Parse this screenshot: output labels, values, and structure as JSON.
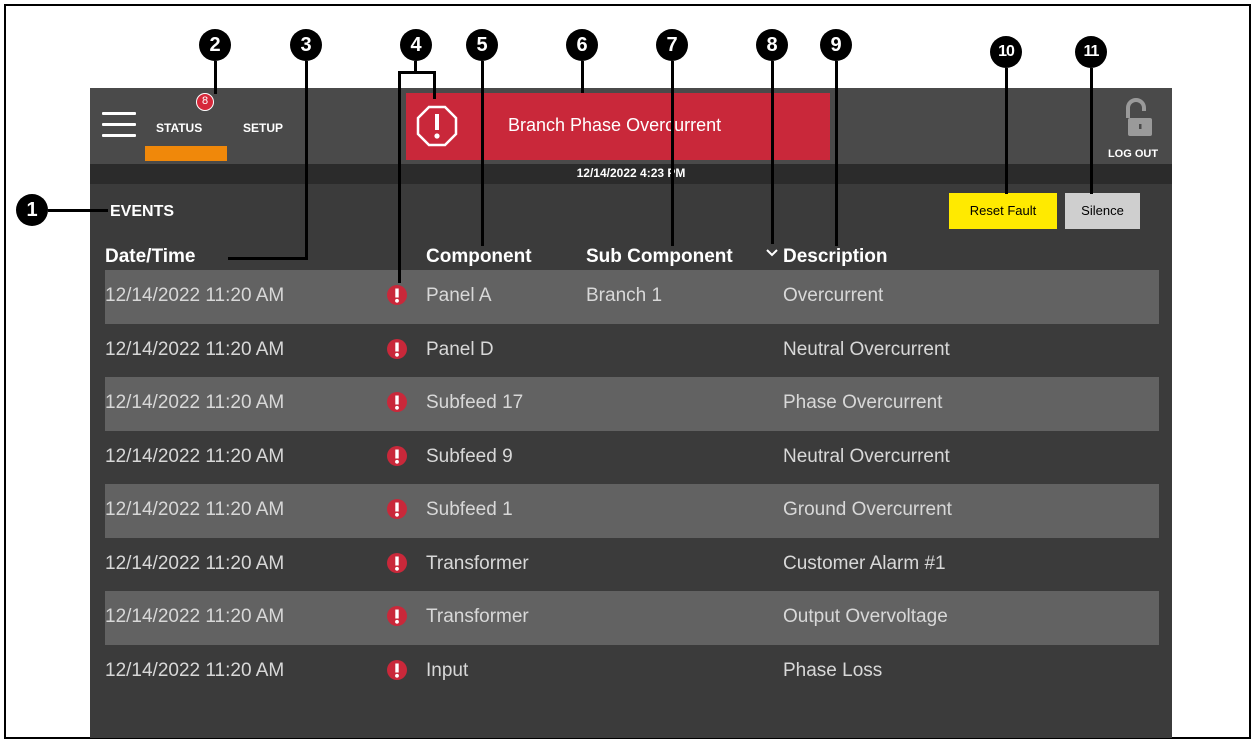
{
  "callouts": [
    "1",
    "2",
    "3",
    "4",
    "5",
    "6",
    "7",
    "8",
    "9",
    "10",
    "11"
  ],
  "nav": {
    "badge_count": "8",
    "status_label": "STATUS",
    "setup_label": "SETUP",
    "logout_label": "LOG OUT"
  },
  "alarm": {
    "text": "Branch Phase Overcurrent"
  },
  "datetime": "12/14/2022 4:23 PM",
  "events": {
    "title": "EVENTS",
    "reset_label": "Reset Fault",
    "silence_label": "Silence",
    "columns": {
      "datetime": "Date/Time",
      "component": "Component",
      "subcomponent": "Sub Component",
      "description": "Description"
    },
    "rows": [
      {
        "datetime": "12/14/2022 11:20 AM",
        "component": "Panel A",
        "subcomponent": "Branch 1",
        "description": "Overcurrent"
      },
      {
        "datetime": "12/14/2022 11:20 AM",
        "component": "Panel D",
        "subcomponent": "",
        "description": "Neutral Overcurrent"
      },
      {
        "datetime": "12/14/2022 11:20 AM",
        "component": "Subfeed 17",
        "subcomponent": "",
        "description": "Phase Overcurrent"
      },
      {
        "datetime": "12/14/2022 11:20 AM",
        "component": "Subfeed 9",
        "subcomponent": "",
        "description": "Neutral Overcurrent"
      },
      {
        "datetime": "12/14/2022 11:20 AM",
        "component": "Subfeed 1",
        "subcomponent": "",
        "description": "Ground Overcurrent"
      },
      {
        "datetime": "12/14/2022 11:20 AM",
        "component": "Transformer",
        "subcomponent": "",
        "description": "Customer Alarm #1"
      },
      {
        "datetime": "12/14/2022 11:20 AM",
        "component": "Transformer",
        "subcomponent": "",
        "description": "Output Overvoltage"
      },
      {
        "datetime": "12/14/2022 11:20 AM",
        "component": "Input",
        "subcomponent": "",
        "description": "Phase Loss"
      }
    ]
  },
  "colors": {
    "alarm_red": "#c9283a",
    "status_underline": "#f0880a",
    "reset_yellow": "#ffea00",
    "silence_gray": "#cfcfcf",
    "row_alt": "#626262",
    "background": "#3b3b3b"
  },
  "icons": [
    "menu-icon",
    "alarm-octagon-icon",
    "alert-circle-icon",
    "sort-chevron-down-icon",
    "lock-open-icon"
  ]
}
